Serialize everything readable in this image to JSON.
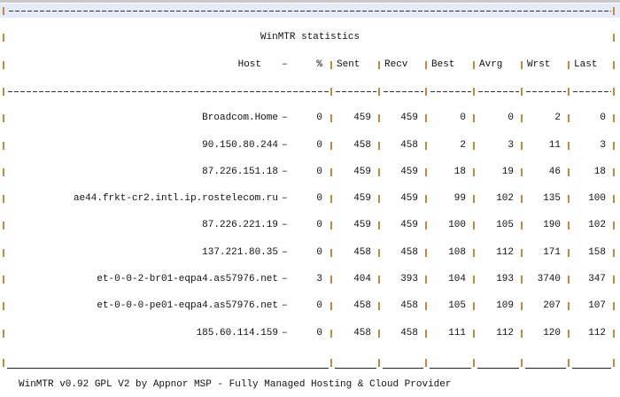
{
  "title": "WinMTR statistics",
  "headers": {
    "host": "Host",
    "dash": "–",
    "pct": "%",
    "sent": "Sent",
    "recv": "Recv",
    "best": "Best",
    "avrg": "Avrg",
    "wrst": "Wrst",
    "last": "Last"
  },
  "rows": [
    {
      "host": "Broadcom.Home",
      "pct": "0",
      "sent": "459",
      "recv": "459",
      "best": "0",
      "avrg": "0",
      "wrst": "2",
      "last": "0"
    },
    {
      "host": "90.150.80.244",
      "pct": "0",
      "sent": "458",
      "recv": "458",
      "best": "2",
      "avrg": "3",
      "wrst": "11",
      "last": "3"
    },
    {
      "host": "87.226.151.18",
      "pct": "0",
      "sent": "459",
      "recv": "459",
      "best": "18",
      "avrg": "19",
      "wrst": "46",
      "last": "18"
    },
    {
      "host": "ae44.frkt-cr2.intl.ip.rostelecom.ru",
      "pct": "0",
      "sent": "459",
      "recv": "459",
      "best": "99",
      "avrg": "102",
      "wrst": "135",
      "last": "100"
    },
    {
      "host": "87.226.221.19",
      "pct": "0",
      "sent": "459",
      "recv": "459",
      "best": "100",
      "avrg": "105",
      "wrst": "190",
      "last": "102"
    },
    {
      "host": "137.221.80.35",
      "pct": "0",
      "sent": "458",
      "recv": "458",
      "best": "108",
      "avrg": "112",
      "wrst": "171",
      "last": "158"
    },
    {
      "host": "et-0-0-2-br01-eqpa4.as57976.net",
      "pct": "3",
      "sent": "404",
      "recv": "393",
      "best": "104",
      "avrg": "193",
      "wrst": "3740",
      "last": "347"
    },
    {
      "host": "et-0-0-0-pe01-eqpa4.as57976.net",
      "pct": "0",
      "sent": "458",
      "recv": "458",
      "best": "105",
      "avrg": "109",
      "wrst": "207",
      "last": "107"
    },
    {
      "host": "185.60.114.159",
      "pct": "0",
      "sent": "458",
      "recv": "458",
      "best": "111",
      "avrg": "112",
      "wrst": "120",
      "last": "112"
    }
  ],
  "footer": "WinMTR v0.92 GPL V2 by Appnor MSP - Fully Managed Hosting & Cloud Provider"
}
